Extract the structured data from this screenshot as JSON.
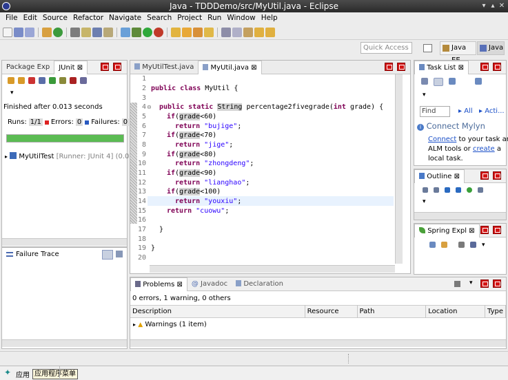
{
  "window": {
    "title": "Java - TDDDemo/src/MyUtil.java - Eclipse"
  },
  "menu": [
    "File",
    "Edit",
    "Source",
    "Refactor",
    "Navigate",
    "Search",
    "Project",
    "Run",
    "Window",
    "Help"
  ],
  "toolbar": {
    "quick_access_placeholder": "Quick Access",
    "persp_javaee": "Java EE",
    "persp_java": "Java"
  },
  "left": {
    "tabs": {
      "package_explorer": "Package Exp",
      "junit": "JUnit"
    },
    "status": "Finished after 0.013 seconds",
    "runs_label": "Runs:",
    "runs_value": "1/1",
    "errors_label": "Errors:",
    "errors_value": "0",
    "failures_label": "Failures:",
    "failures_value": "0",
    "progress_fraction": 1.0,
    "progress_color": "#5bbc53",
    "test_item": "MyUtilTest",
    "test_meta": "[Runner: JUnit 4] (0.00",
    "failure_trace": "Failure Trace"
  },
  "editor": {
    "tabs": {
      "tab1": "MyUtilTest.java",
      "tab2": "MyUtil.java"
    },
    "line_numbers": [
      "1",
      "2",
      "3",
      "4",
      "5",
      "6",
      "7",
      "8",
      "9",
      "10",
      "11",
      "12",
      "13",
      "14",
      "15",
      "16",
      "17",
      "18",
      "19",
      "20"
    ],
    "kw_public": "public",
    "kw_class": "class",
    "class_name": " MyUtil {",
    "kw_static": "static",
    "type_string": "String",
    "method_name": " percentage2fivegrade(",
    "kw_int": "int",
    "param": " grade) {",
    "kw_if": "if",
    "kw_return": "return",
    "var_grade": "grade",
    "cond": [
      "<60)",
      "<70)",
      "<80)",
      "<90)",
      "<100)"
    ],
    "strings": [
      "\"bujige\"",
      "\"jige\"",
      "\"zhongdeng\"",
      "\"lianghao\"",
      "\"youxiu\"",
      "\"cuowu\""
    ],
    "brace_close": "}",
    "semi": ";",
    "paren_open": "("
  },
  "right": {
    "tasklist": {
      "title": "Task List",
      "find_placeholder": "Find",
      "all": "All",
      "acti": "Acti..."
    },
    "mylyn": {
      "title": "Connect Mylyn",
      "link_connect": "Connect",
      "text1": " to your task and",
      "text2": "ALM tools or ",
      "link_create": "create",
      "text3": " a",
      "text4": "local task."
    },
    "outline": {
      "title": "Outline"
    },
    "spring": {
      "title": "Spring Expl"
    }
  },
  "bottom": {
    "tabs": {
      "problems": "Problems",
      "javadoc": "Javadoc",
      "declaration": "Declaration"
    },
    "summary": "0 errors, 1 warning, 0 others",
    "columns": [
      "Description",
      "Resource",
      "Path",
      "Location",
      "Type"
    ],
    "row": "Warnings (1 item)"
  },
  "taskbar": {
    "app_label": "应用",
    "tooltip": "应用程序菜单"
  }
}
